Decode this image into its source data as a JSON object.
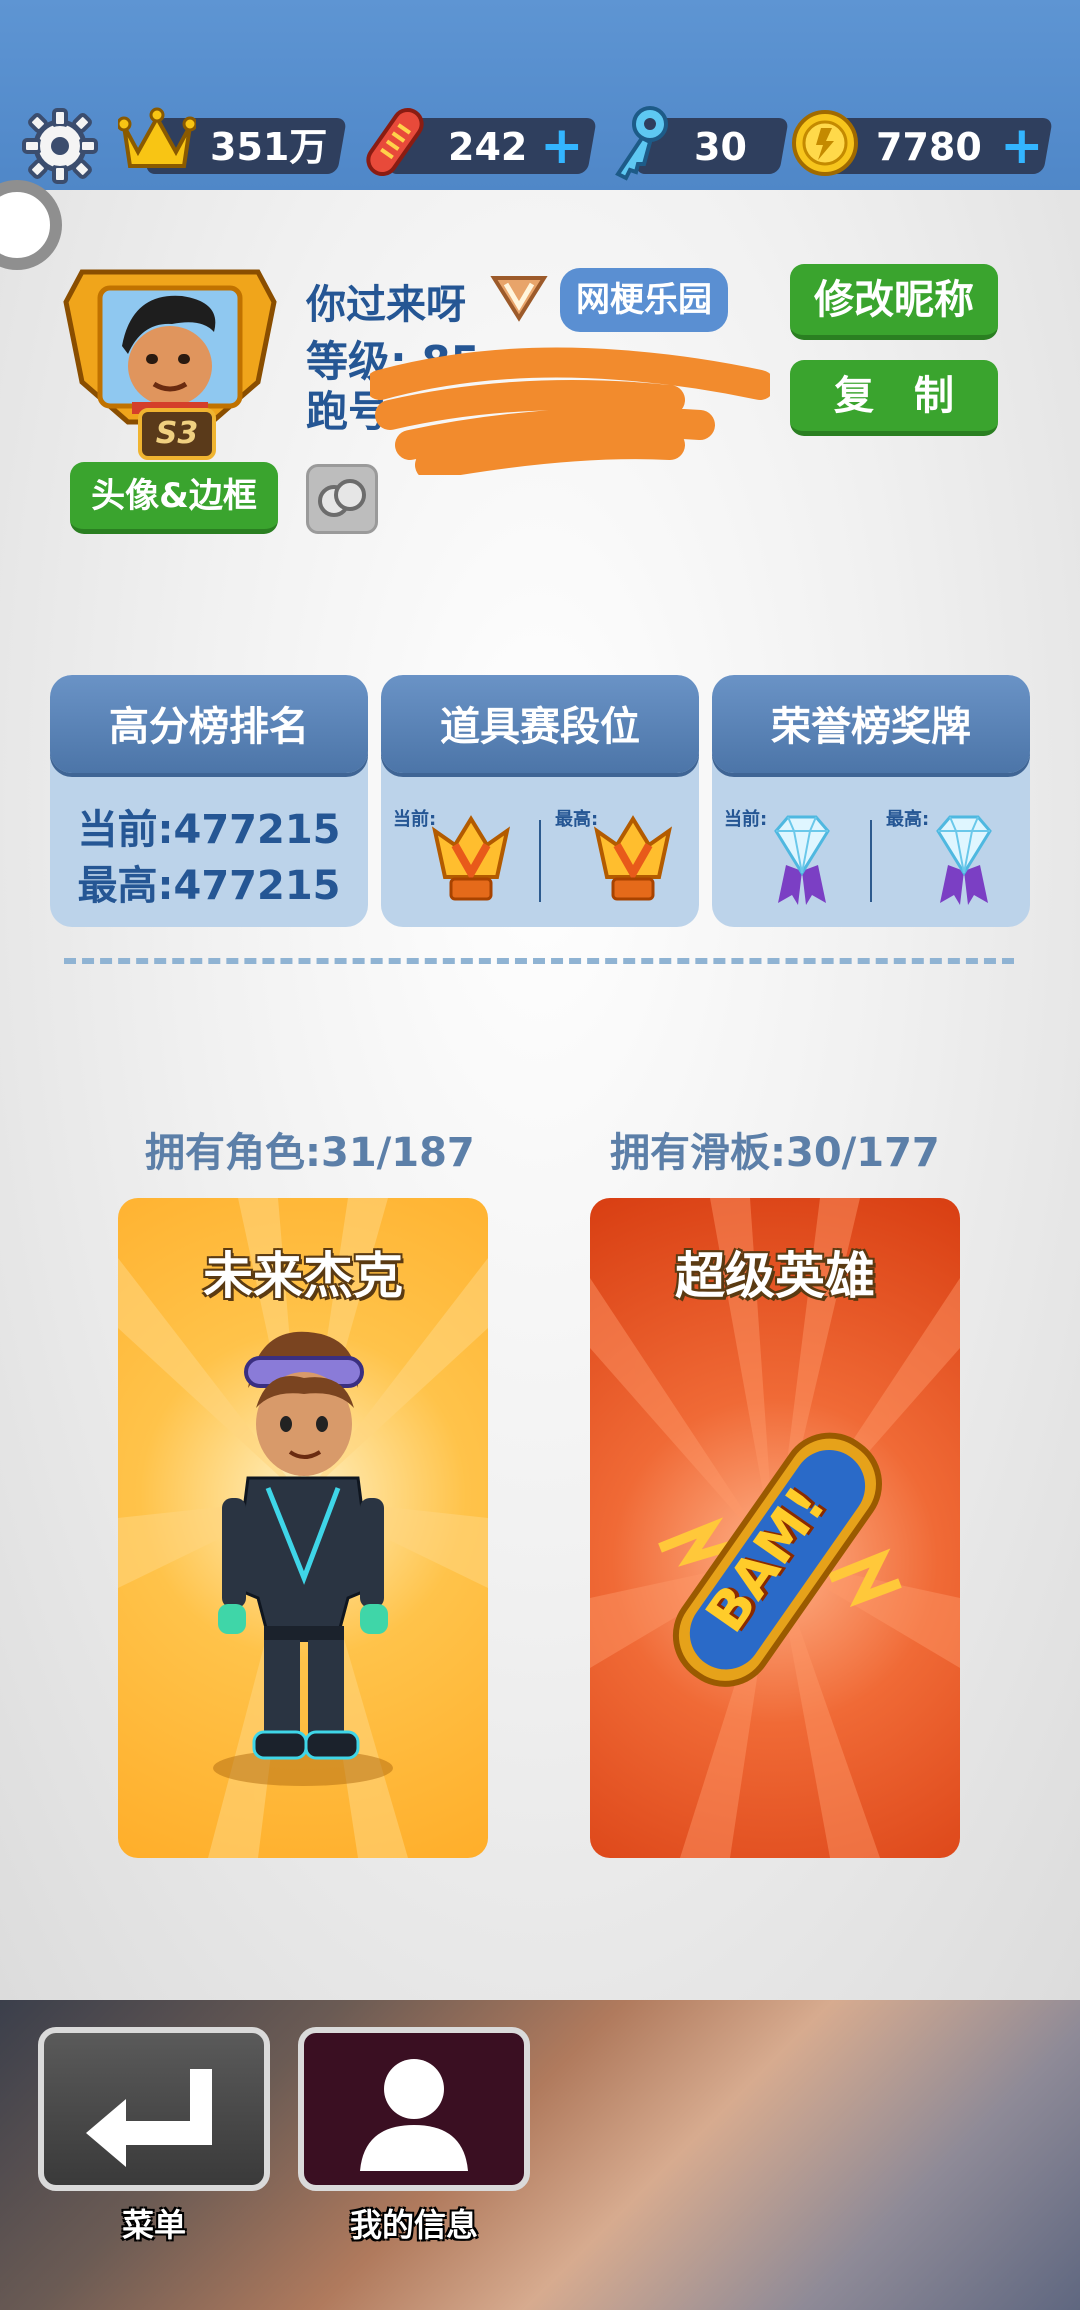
{
  "currencies": {
    "score": "351万",
    "boards": "242",
    "keys": "30",
    "coins": "7780"
  },
  "profile": {
    "nickname": "你过来呀",
    "crew_tag": "网梗乐园",
    "level_text": "等级: 85",
    "id_text": "跑号:",
    "season_badge": "S3",
    "avatar_frame_button": "头像&边框",
    "rename_button": "修改昵称",
    "copy_button": "复　制"
  },
  "stats": {
    "highscore": {
      "title": "高分榜排名",
      "current": "当前:477215",
      "best": "最高:477215"
    },
    "items": {
      "title": "道具赛段位",
      "current_label": "当前:",
      "best_label": "最高:"
    },
    "honor": {
      "title": "荣誉榜奖牌",
      "current_label": "当前:",
      "best_label": "最高:"
    }
  },
  "collection": {
    "characters_owned": "拥有角色:31/187",
    "boards_owned": "拥有滑板:30/177",
    "character_name": "未来杰克",
    "board_name": "超级英雄",
    "board_graphic_text": "BAM!"
  },
  "nav": {
    "menu_label": "菜单",
    "my_info_label": "我的信息"
  },
  "colors": {
    "topbar": "#5a90cf",
    "accent_green": "#3aa42e",
    "text_blue": "#255694",
    "plus_blue": "#33b5ff",
    "character_card": "#ffb43a",
    "board_card": "#e0481b"
  }
}
